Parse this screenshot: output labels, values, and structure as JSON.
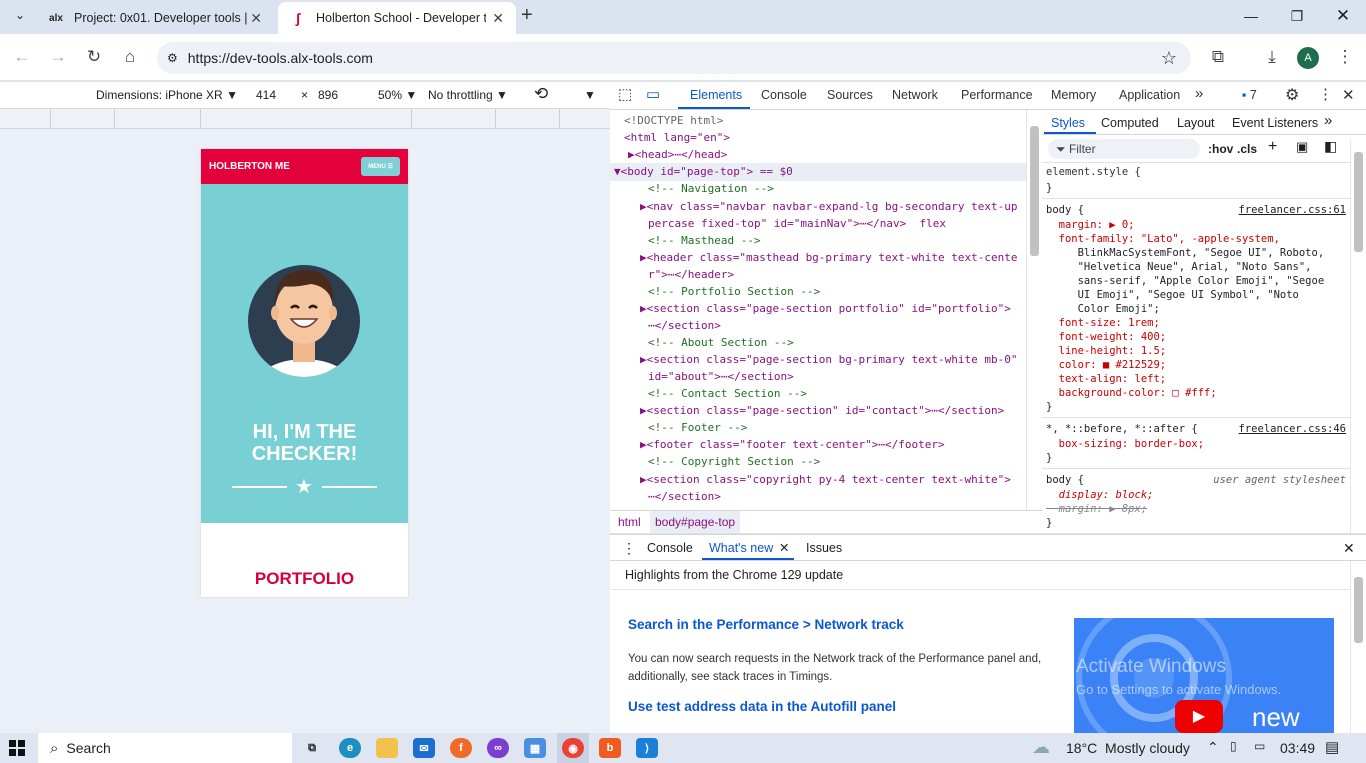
{
  "browser": {
    "tabs": [
      {
        "label": "Project: 0x01. Developer tools |",
        "favicon": "alx"
      },
      {
        "label": "Holberton School - Developer t",
        "favicon": "holberton-logo"
      }
    ],
    "new_tab": "+",
    "url": "https://dev-tools.alx-tools.com",
    "profile_initial": "A"
  },
  "device_toolbar": {
    "device": "Dimensions: iPhone XR",
    "width": "414",
    "times": "×",
    "height": "896",
    "zoom": "50%",
    "throttle": "No throttling"
  },
  "page": {
    "brand": "HOLBERTON ME",
    "menu": "MENU ☰",
    "heading_line1": "HI, I'M THE",
    "heading_line2": "CHECKER!",
    "section": "PORTFOLIO"
  },
  "devtools": {
    "tabs": [
      "Elements",
      "Console",
      "Sources",
      "Network",
      "Performance",
      "Memory",
      "Application"
    ],
    "more": "»",
    "issues_count": "7",
    "dom_lines": [
      {
        "text": "<!DOCTYPE html>",
        "cls": "cm2"
      },
      {
        "text": "<html lang=\"en\">"
      },
      {
        "text": "▶<head>⋯</head>"
      },
      {
        "text": "▼<body id=\"page-top\"> == $0"
      },
      {
        "text": "<!-- Navigation -->"
      },
      {
        "text": "▶<nav class=\"navbar navbar-expand-lg bg-secondary text-up"
      },
      {
        "text": "percase fixed-top\" id=\"mainNav\">⋯</nav>  flex"
      },
      {
        "text": "<!-- Masthead -->"
      },
      {
        "text": "▶<header class=\"masthead bg-primary text-white text-cente"
      },
      {
        "text": "r\">⋯</header>"
      },
      {
        "text": "<!-- Portfolio Section -->"
      },
      {
        "text": "▶<section class=\"page-section portfolio\" id=\"portfolio\">"
      },
      {
        "text": "⋯</section>"
      },
      {
        "text": "<!-- About Section -->"
      },
      {
        "text": "▶<section class=\"page-section bg-primary text-white mb-0\""
      },
      {
        "text": "id=\"about\">⋯</section>"
      },
      {
        "text": "<!-- Contact Section -->"
      },
      {
        "text": "▶<section class=\"page-section\" id=\"contact\">⋯</section>"
      },
      {
        "text": "<!-- Footer -->"
      },
      {
        "text": "▶<footer class=\"footer text-center\">⋯</footer>"
      },
      {
        "text": "<!-- Copyright Section -->"
      },
      {
        "text": "▶<section class=\"copyright py-4 text-center text-white\">"
      },
      {
        "text": "⋯</section>"
      }
    ],
    "breadcrumbs": [
      "html",
      "body#page-top"
    ],
    "styles_tabs": [
      "Styles",
      "Computed",
      "Layout",
      "Event Listeners"
    ],
    "filter_placeholder": "Filter",
    "hov": ":hov",
    "cls": ".cls",
    "styles_lines": [
      "element.style {",
      "}",
      "body {",
      "  margin: ▶ 0;",
      "  font-family: \"Lato\", -apple-system,",
      "     BlinkMacSystemFont, \"Segoe UI\", Roboto,",
      "     \"Helvetica Neue\", Arial, \"Noto Sans\",",
      "     sans-serif, \"Apple Color Emoji\", \"Segoe",
      "     UI Emoji\", \"Segoe UI Symbol\", \"Noto",
      "     Color Emoji\";",
      "  font-size: 1rem;",
      "  font-weight: 400;",
      "  line-height: 1.5;",
      "  color: ■ #212529;",
      "  text-align: left;",
      "  background-color: □ #fff;",
      "}",
      "*, *::before, *::after {",
      "  box-sizing: border-box;",
      "}",
      "body {",
      "  display: block;",
      "  margin: ▶ 8px;",
      "}"
    ],
    "style_sources": [
      "freelancer.css:61",
      "freelancer.css:46",
      "user agent stylesheet"
    ],
    "drawer_tabs": [
      "Console",
      "What's new",
      "Issues"
    ],
    "whats_new": {
      "highlight": "Highlights from the Chrome 129 update",
      "h1": "Search in the Performance > Network track",
      "p1": "You can now search requests in the Network track of the Performance panel and, additionally, see stack traces in Timings.",
      "h2": "Use test address data in the Autofill panel",
      "video_label": "new",
      "watermark1": "Activate Windows",
      "watermark2": "Go to Settings to activate Windows."
    }
  },
  "taskbar": {
    "search": "Search",
    "weather": "18°C  Mostly cloudy",
    "time": "03:49"
  },
  "colors": {
    "accent": "#0b57d0",
    "brand_red": "#e4003a",
    "teal": "#78cfd4"
  }
}
